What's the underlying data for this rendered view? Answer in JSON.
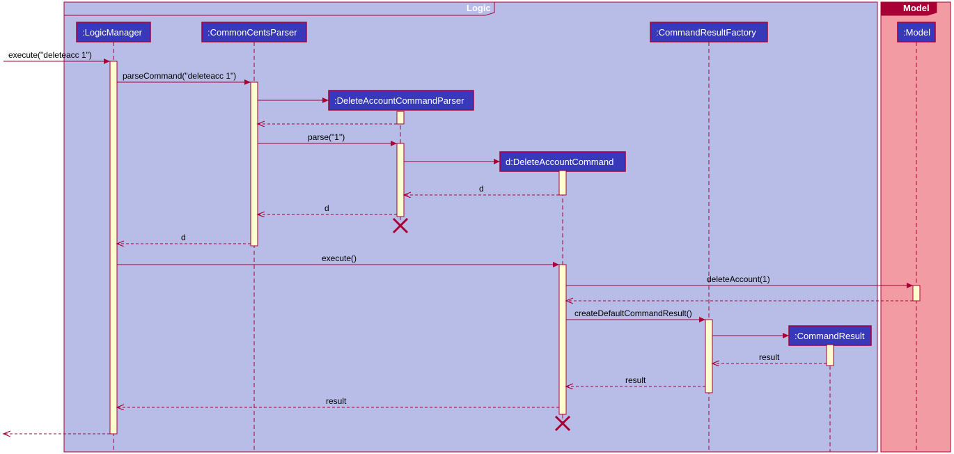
{
  "frames": {
    "logic": {
      "label": "Logic"
    },
    "model": {
      "label": "Model"
    }
  },
  "participants": {
    "logicManager": {
      "label": ":LogicManager"
    },
    "commonCentsParser": {
      "label": ":CommonCentsParser"
    },
    "deleteAccountCommandParser": {
      "label": ":DeleteAccountCommandParser"
    },
    "deleteAccountCommand": {
      "label": "d:DeleteAccountCommand"
    },
    "commandResultFactory": {
      "label": ":CommandResultFactory"
    },
    "commandResult": {
      "label": ":CommandResult"
    },
    "model": {
      "label": ":Model"
    }
  },
  "messages": {
    "m1": "execute(\"deleteacc 1\")",
    "m2": "parseCommand(\"deleteacc 1\")",
    "m3": "parse(\"1\")",
    "m4": "d",
    "m5": "d",
    "m6": "d",
    "m7": "execute()",
    "m8": "deleteAccount(1)",
    "m9": "createDefaultCommandResult()",
    "m10": "result",
    "m11": "result",
    "m12": "result"
  },
  "chart_data": {
    "type": "sequence_diagram",
    "frames": [
      {
        "name": "Logic",
        "contains": [
          "LogicManager",
          "CommonCentsParser",
          "DeleteAccountCommandParser",
          "DeleteAccountCommand",
          "CommandResultFactory",
          "CommandResult"
        ]
      },
      {
        "name": "Model",
        "contains": [
          "Model"
        ]
      }
    ],
    "lifelines": [
      {
        "id": "LogicManager",
        "label": ":LogicManager",
        "created_at": 0
      },
      {
        "id": "CommonCentsParser",
        "label": ":CommonCentsParser",
        "created_at": 0
      },
      {
        "id": "DeleteAccountCommandParser",
        "label": ":DeleteAccountCommandParser",
        "created_at": 3,
        "destroyed_at": 9
      },
      {
        "id": "DeleteAccountCommand",
        "label": "d:DeleteAccountCommand",
        "created_at": 5,
        "destroyed_at": 17
      },
      {
        "id": "CommandResultFactory",
        "label": ":CommandResultFactory",
        "created_at": 0
      },
      {
        "id": "CommandResult",
        "label": ":CommandResult",
        "created_at": 13
      },
      {
        "id": "Model",
        "label": ":Model",
        "created_at": 0
      }
    ],
    "messages": [
      {
        "seq": 1,
        "from": "<<external>>",
        "to": "LogicManager",
        "label": "execute(\"deleteacc 1\")",
        "type": "sync"
      },
      {
        "seq": 2,
        "from": "LogicManager",
        "to": "CommonCentsParser",
        "label": "parseCommand(\"deleteacc 1\")",
        "type": "sync"
      },
      {
        "seq": 3,
        "from": "CommonCentsParser",
        "to": "DeleteAccountCommandParser",
        "label": "",
        "type": "create"
      },
      {
        "seq": 4,
        "from": "DeleteAccountCommandParser",
        "to": "CommonCentsParser",
        "label": "",
        "type": "return"
      },
      {
        "seq": 5,
        "from": "CommonCentsParser",
        "to": "DeleteAccountCommandParser",
        "label": "parse(\"1\")",
        "type": "sync"
      },
      {
        "seq": 6,
        "from": "DeleteAccountCommandParser",
        "to": "DeleteAccountCommand",
        "label": "",
        "type": "create"
      },
      {
        "seq": 7,
        "from": "DeleteAccountCommand",
        "to": "DeleteAccountCommandParser",
        "label": "d",
        "type": "return"
      },
      {
        "seq": 8,
        "from": "DeleteAccountCommandParser",
        "to": "CommonCentsParser",
        "label": "d",
        "type": "return"
      },
      {
        "seq": 9,
        "from": "CommonCentsParser",
        "to": "LogicManager",
        "label": "d",
        "type": "return"
      },
      {
        "seq": 10,
        "from": "LogicManager",
        "to": "DeleteAccountCommand",
        "label": "execute()",
        "type": "sync"
      },
      {
        "seq": 11,
        "from": "DeleteAccountCommand",
        "to": "Model",
        "label": "deleteAccount(1)",
        "type": "sync"
      },
      {
        "seq": 12,
        "from": "Model",
        "to": "DeleteAccountCommand",
        "label": "",
        "type": "return"
      },
      {
        "seq": 13,
        "from": "DeleteAccountCommand",
        "to": "CommandResultFactory",
        "label": "createDefaultCommandResult()",
        "type": "sync"
      },
      {
        "seq": 14,
        "from": "CommandResultFactory",
        "to": "CommandResult",
        "label": "",
        "type": "create"
      },
      {
        "seq": 15,
        "from": "CommandResult",
        "to": "CommandResultFactory",
        "label": "result",
        "type": "return"
      },
      {
        "seq": 16,
        "from": "CommandResultFactory",
        "to": "DeleteAccountCommand",
        "label": "result",
        "type": "return"
      },
      {
        "seq": 17,
        "from": "DeleteAccountCommand",
        "to": "LogicManager",
        "label": "result",
        "type": "return"
      },
      {
        "seq": 18,
        "from": "LogicManager",
        "to": "<<external>>",
        "label": "",
        "type": "return"
      }
    ]
  }
}
